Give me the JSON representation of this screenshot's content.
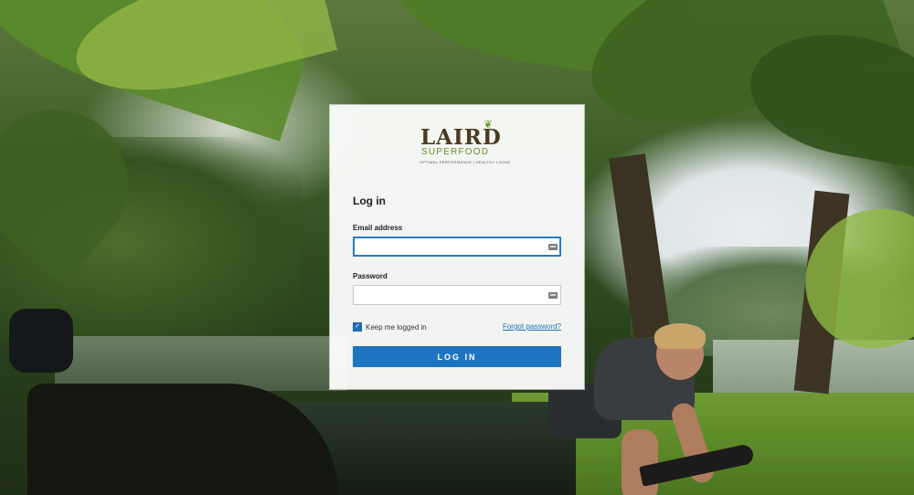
{
  "brand": {
    "logo_word": "LAIRD",
    "logo_sub": "SUPERFOOD",
    "logo_tagline": "OPTIMAL PERFORMANCE | HEALTHY LIVING",
    "logo_color": "#4a3a22",
    "accent_color": "#6f9a2d"
  },
  "login": {
    "title": "Log in",
    "email_label": "Email address",
    "email_value": "",
    "password_label": "Password",
    "password_value": "",
    "keep_logged_in_label": "Keep me logged in",
    "keep_logged_in_checked": true,
    "forgot_password": "Forgot password?",
    "submit_label": "LOG IN",
    "button_color": "#1f74c1",
    "focus_color": "#2a7ac2"
  },
  "icons": {
    "email_field_icon": "autofill-card-icon",
    "password_field_icon": "autofill-card-icon",
    "checkbox": "checkmark-icon",
    "logo_leaf": "leaf-icon"
  }
}
